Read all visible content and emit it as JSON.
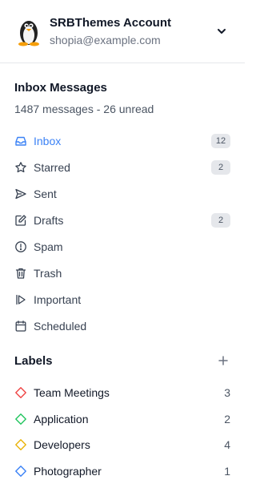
{
  "account": {
    "name": "SRBThemes Account",
    "email": "shopia@example.com",
    "avatar_icon": "penguin-avatar",
    "toggle_icon": "chevron-down-icon"
  },
  "inbox": {
    "title": "Inbox Messages",
    "summary": "1487 messages - 26 unread"
  },
  "nav": [
    {
      "label": "Inbox",
      "icon": "inbox-icon",
      "badge": "12",
      "active": true
    },
    {
      "label": "Starred",
      "icon": "star-icon",
      "badge": "2"
    },
    {
      "label": "Sent",
      "icon": "send-icon"
    },
    {
      "label": "Drafts",
      "icon": "edit-icon",
      "badge": "2"
    },
    {
      "label": "Spam",
      "icon": "alert-circle-icon"
    },
    {
      "label": "Trash",
      "icon": "trash-icon"
    },
    {
      "label": "Important",
      "icon": "important-icon"
    },
    {
      "label": "Scheduled",
      "icon": "calendar-icon"
    }
  ],
  "labels": {
    "title": "Labels",
    "add_icon": "plus-icon",
    "items": [
      {
        "label": "Team Meetings",
        "count": "3",
        "color": "#ef4444"
      },
      {
        "label": "Application",
        "count": "2",
        "color": "#22c55e"
      },
      {
        "label": "Developers",
        "count": "4",
        "color": "#eab308"
      },
      {
        "label": "Photographer",
        "count": "1",
        "color": "#3b82f6"
      }
    ]
  },
  "colors": {
    "active": "#3b82f6",
    "badge_bg": "#e5e7eb"
  }
}
